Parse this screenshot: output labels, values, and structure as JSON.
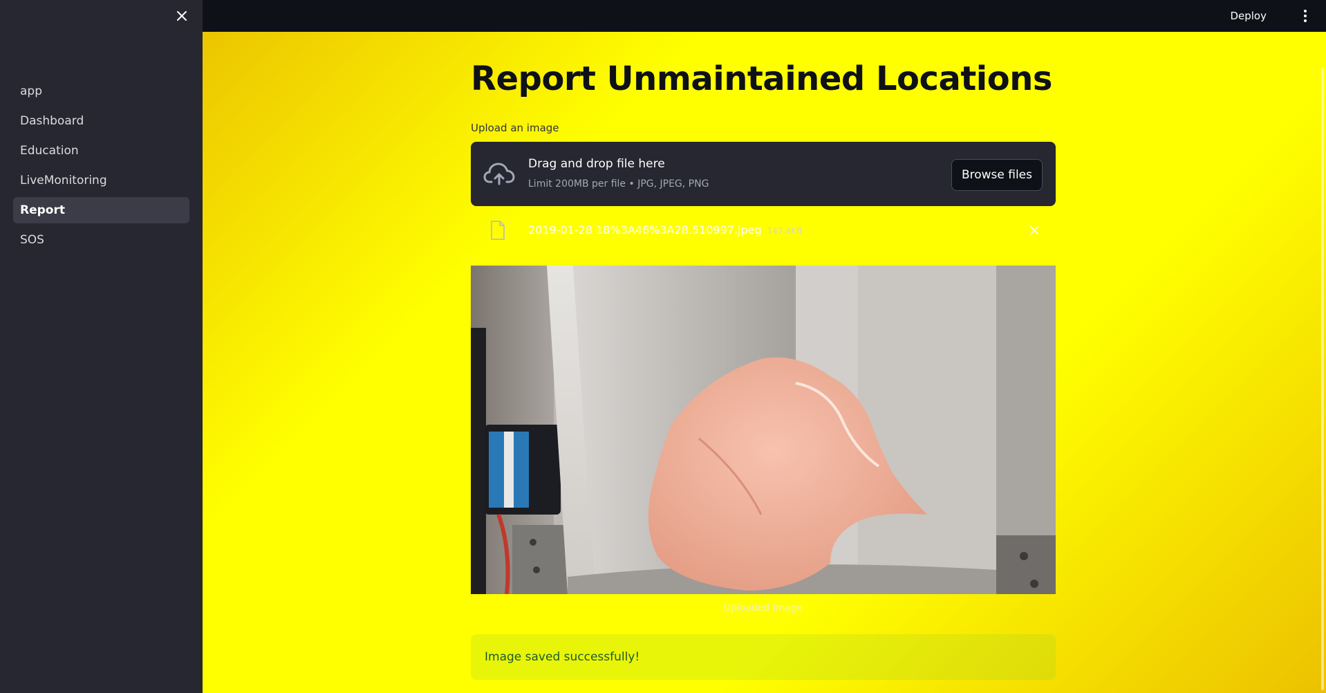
{
  "sidebar": {
    "items": [
      {
        "label": "app",
        "active": false
      },
      {
        "label": "Dashboard",
        "active": false
      },
      {
        "label": "Education",
        "active": false
      },
      {
        "label": "LiveMonitoring",
        "active": false
      },
      {
        "label": "Report",
        "active": true
      },
      {
        "label": "SOS",
        "active": false
      }
    ]
  },
  "header": {
    "deploy_label": "Deploy"
  },
  "main": {
    "title": "Report Unmaintained Locations",
    "uploader": {
      "label": "Upload an image",
      "drop_title": "Drag and drop file here",
      "limit_text": "Limit 200MB per file • JPG, JPEG, PNG",
      "browse_label": "Browse files"
    },
    "file": {
      "name": "2019-01-28 18%3A46%3A28.510997.jpeg",
      "size": "147.4KB"
    },
    "image_caption": "Uploaded Image",
    "success_message": "Image saved successfully!"
  },
  "colors": {
    "sidebar_bg": "#262730",
    "topbar_bg": "#0e1117",
    "main_bg": "#ffff00",
    "success_text": "#1c5a2a"
  },
  "icons": [
    "close-icon",
    "kebab-menu-icon",
    "cloud-upload-icon",
    "file-icon",
    "remove-file-icon"
  ]
}
